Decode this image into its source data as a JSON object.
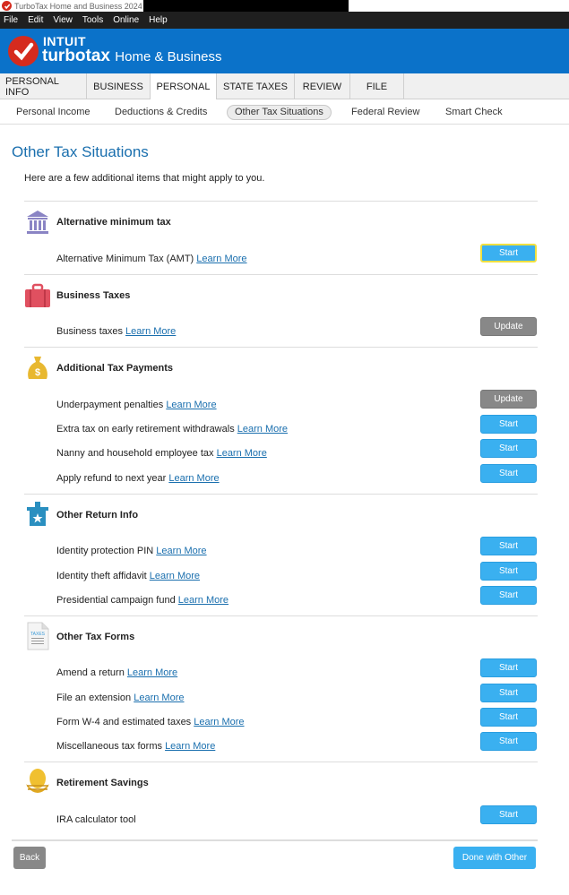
{
  "window": {
    "title": "TurboTax Home and Business 2024 -"
  },
  "menu": [
    "File",
    "Edit",
    "View",
    "Tools",
    "Online",
    "Help"
  ],
  "brand": {
    "intuit": "INTUIT",
    "product": "turbotax",
    "edition": "Home & Business"
  },
  "tabs": [
    "PERSONAL INFO",
    "BUSINESS",
    "PERSONAL",
    "STATE TAXES",
    "REVIEW",
    "FILE"
  ],
  "active_tab": "PERSONAL",
  "subnav": [
    "Personal Income",
    "Deductions & Credits",
    "Other Tax Situations",
    "Federal Review",
    "Smart Check"
  ],
  "active_subnav": "Other Tax Situations",
  "page": {
    "title": "Other Tax Situations",
    "intro": "Here are a few additional items that might apply to you."
  },
  "learn_more": "Learn More",
  "sections": [
    {
      "title": "Alternative minimum tax",
      "icon": "bank-icon",
      "items": [
        {
          "label": "Alternative Minimum Tax (AMT)",
          "button": "Start"
        }
      ]
    },
    {
      "title": "Business Taxes",
      "icon": "briefcase-icon",
      "items": [
        {
          "label": "Business taxes",
          "button": "Update"
        }
      ]
    },
    {
      "title": "Additional Tax Payments",
      "icon": "money-bag-icon",
      "items": [
        {
          "label": "Underpayment penalties",
          "button": "Update"
        },
        {
          "label": "Extra tax on early retirement withdrawals",
          "button": "Start"
        },
        {
          "label": "Nanny and household employee tax",
          "button": "Start"
        },
        {
          "label": "Apply refund to next year",
          "button": "Start"
        }
      ]
    },
    {
      "title": "Other Return Info",
      "icon": "ballot-box-icon",
      "items": [
        {
          "label": "Identity protection PIN",
          "button": "Start"
        },
        {
          "label": "Identity theft affidavit",
          "button": "Start"
        },
        {
          "label": "Presidential campaign fund",
          "button": "Start"
        }
      ]
    },
    {
      "title": "Other Tax Forms",
      "icon": "tax-document-icon",
      "icon_text": "TAXES",
      "items": [
        {
          "label": "Amend a return",
          "button": "Start"
        },
        {
          "label": "File an extension",
          "button": "Start"
        },
        {
          "label": "Form W-4 and estimated taxes",
          "button": "Start"
        },
        {
          "label": "Miscellaneous tax forms",
          "button": "Start"
        }
      ]
    },
    {
      "title": "Retirement Savings",
      "icon": "nest-egg-icon",
      "items": [
        {
          "label": "IRA calculator tool",
          "button": "Start"
        }
      ]
    }
  ],
  "footer": {
    "back": "Back",
    "done": "Done with Other"
  },
  "colors": {
    "brand_blue": "#0b72c9",
    "start_button": "#3ab0f0",
    "update_button": "#888888",
    "link": "#1a6fae",
    "title": "#1a6fae"
  }
}
